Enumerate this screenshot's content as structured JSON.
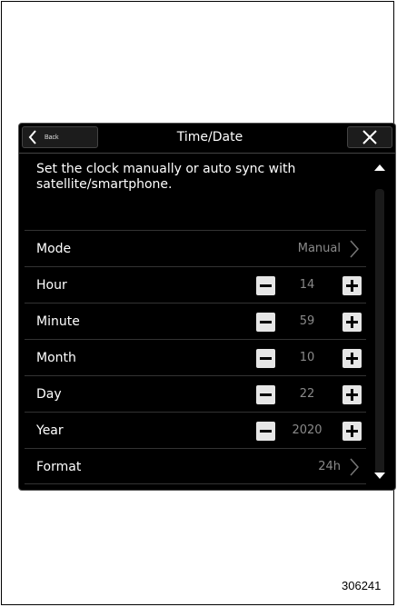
{
  "header": {
    "back_label": "Back",
    "title": "Time/Date"
  },
  "description": "Set the clock manually or auto sync with satellite/smartphone.",
  "rows": [
    {
      "label": "Mode",
      "value": "Manual",
      "control": "chevron"
    },
    {
      "label": "Hour",
      "value": "14",
      "control": "stepper"
    },
    {
      "label": "Minute",
      "value": "59",
      "control": "stepper"
    },
    {
      "label": "Month",
      "value": "10",
      "control": "stepper"
    },
    {
      "label": "Day",
      "value": "22",
      "control": "stepper"
    },
    {
      "label": "Year",
      "value": "2020",
      "control": "stepper"
    },
    {
      "label": "Format",
      "value": "24h",
      "control": "chevron"
    }
  ],
  "figure_code": "306241",
  "colors": {
    "screen_bg": "#000000",
    "text": "#ffffff",
    "value_text": "#8a8a8a",
    "stepper_bg": "#e6e6e6"
  }
}
